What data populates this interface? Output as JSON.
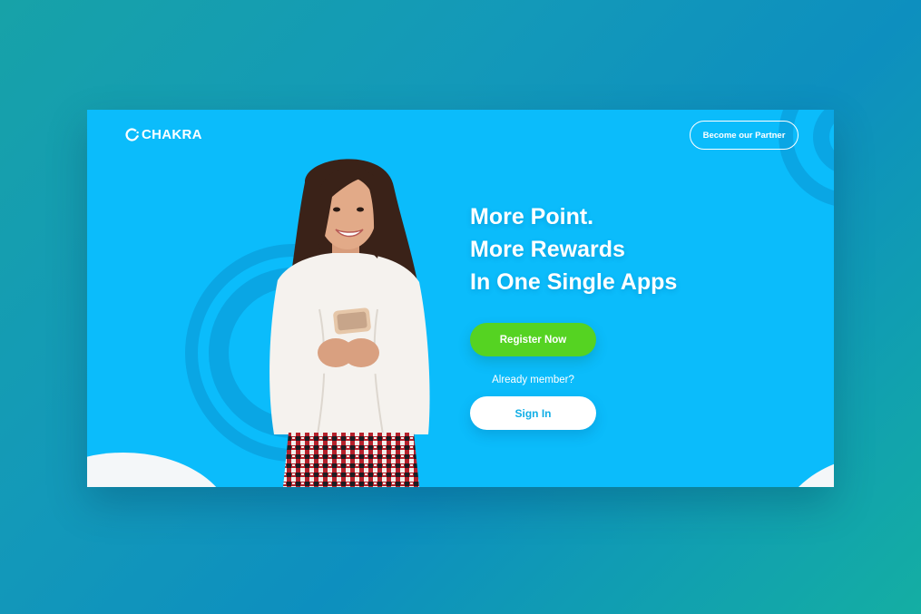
{
  "brand": {
    "name": "CHAKRA",
    "logo_icon": "chakra-ring-logo"
  },
  "header": {
    "partner_button_label": "Become our Partner"
  },
  "hero": {
    "headline_lines": [
      "More Point.",
      "More Rewards",
      "In One Single Apps"
    ],
    "register_label": "Register Now",
    "member_prompt": "Already member?",
    "signin_label": "Sign In",
    "image_subject": "smiling-woman-holding-phone"
  },
  "colors": {
    "background_gradient_start": "#17a2a8",
    "background_gradient_end": "#0d8fbf",
    "card_background": "#0bbcfb",
    "ring_color": "#0aa6e4",
    "register_button": "#55d322",
    "signin_text": "#11aee6",
    "text_primary": "#ffffff"
  }
}
